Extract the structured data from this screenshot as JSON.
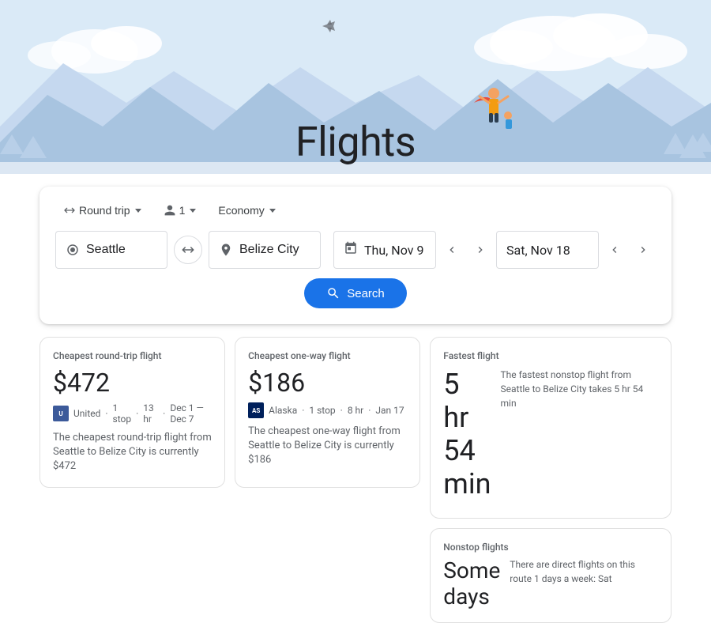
{
  "hero": {
    "title": "Flights"
  },
  "search": {
    "trip_type": "Round trip",
    "passengers": "1",
    "cabin": "Economy",
    "origin": "Seattle",
    "destination": "Belize City",
    "date_depart": "Thu, Nov 9",
    "date_return": "Sat, Nov 18",
    "search_label": "Search"
  },
  "cards": {
    "cheapest_roundtrip": {
      "label": "Cheapest round-trip flight",
      "price": "$472",
      "airline": "United",
      "stops": "1 stop",
      "duration": "13 hr",
      "dates": "Dec 1 — Dec 7",
      "description": "The cheapest round-trip flight from Seattle to Belize City is currently $472"
    },
    "cheapest_oneway": {
      "label": "Cheapest one-way flight",
      "price": "$186",
      "airline": "Alaska",
      "stops": "1 stop",
      "duration": "8 hr",
      "date": "Jan 17",
      "description": "The cheapest one-way flight from Seattle to Belize City is currently $186"
    },
    "fastest": {
      "label": "Fastest flight",
      "time": "5 hr 54 min",
      "description": "The fastest nonstop flight from Seattle to Belize City takes 5 hr 54 min"
    },
    "nonstop": {
      "label": "Nonstop flights",
      "heading": "Some days",
      "description": "There are direct flights on this route 1 days a week: Sat"
    }
  }
}
